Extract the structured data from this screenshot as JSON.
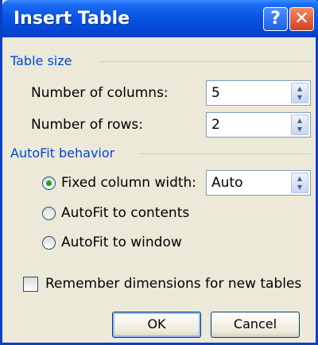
{
  "window": {
    "title": "Insert Table",
    "help_label": "?",
    "close_label": "✕"
  },
  "table_size": {
    "group_label": "Table size",
    "columns_label": "Number of columns:",
    "columns_value": "5",
    "rows_label": "Number of rows:",
    "rows_value": "2"
  },
  "autofit": {
    "group_label": "AutoFit behavior",
    "fixed_label": "Fixed column width:",
    "fixed_value": "Auto",
    "contents_label": "AutoFit to contents",
    "window_label": "AutoFit to window",
    "selected": "fixed"
  },
  "remember_label": "Remember dimensions for new tables",
  "remember_checked": false,
  "buttons": {
    "ok": "OK",
    "cancel": "Cancel"
  },
  "colors": {
    "titlebar": "#0a55e4",
    "group_label": "#0046d5",
    "dialog_bg": "#ece9d8"
  },
  "icons": {
    "spinner": "spin-arrows-icon"
  }
}
